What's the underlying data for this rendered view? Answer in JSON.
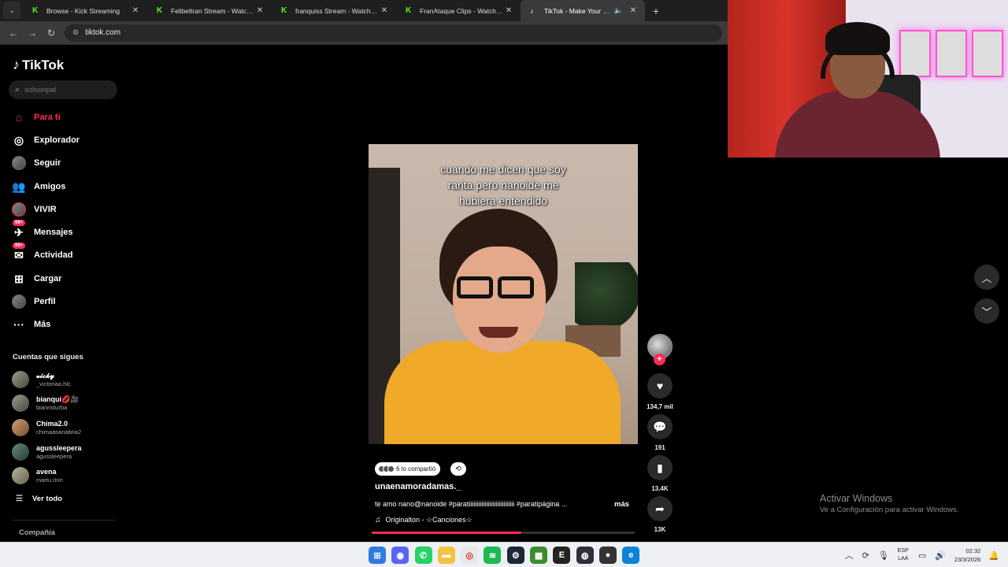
{
  "browser": {
    "tabs": [
      {
        "title": "Browse - Kick Streaming",
        "favicon": "kick-icon",
        "active": false
      },
      {
        "title": "Felibeltran Stream - Watch Live",
        "favicon": "kick-icon",
        "active": false
      },
      {
        "title": "franquiss Stream - Watch Live o",
        "favicon": "kick-icon",
        "active": false
      },
      {
        "title": "FranAtaque Clips - Watch Live o",
        "favicon": "kick-icon",
        "active": false
      },
      {
        "title": "TikTok - Make Your Day",
        "favicon": "tiktok-icon",
        "active": true
      }
    ],
    "url": "tiktok.com"
  },
  "tiktok": {
    "logo_text": "TikTok",
    "search_placeholder": "solsonpai",
    "nav": [
      {
        "label": "Para ti",
        "icon": "home-icon",
        "active": true
      },
      {
        "label": "Explorador",
        "icon": "compass-icon"
      },
      {
        "label": "Seguir",
        "icon": "following-avatar-icon"
      },
      {
        "label": "Amigos",
        "icon": "friends-icon"
      },
      {
        "label": "VIVIR",
        "icon": "live-icon"
      },
      {
        "label": "Mensajes",
        "icon": "messages-icon",
        "badge": "99+"
      },
      {
        "label": "Actividad",
        "icon": "activity-icon",
        "badge": "99+"
      },
      {
        "label": "Cargar",
        "icon": "upload-icon"
      },
      {
        "label": "Perfil",
        "icon": "profile-avatar-icon"
      },
      {
        "label": "Más",
        "icon": "more-dots-icon"
      }
    ],
    "following_title": "Cuentas que sigues",
    "following": [
      {
        "name": "𝓿𝓲𝓬𝓴𝔂",
        "handle": "_victoriaa.hlc"
      },
      {
        "name": "bianqui💋🎥",
        "handle": "biannsturba"
      },
      {
        "name": "Chima2.0",
        "handle": "chimaasanabria2"
      },
      {
        "name": "agussleepera",
        "handle": "agussleepera"
      },
      {
        "name": "avena",
        "handle": "martu.rinn"
      }
    ],
    "see_all": "Ver todo",
    "company": "Compañía"
  },
  "video": {
    "caption": "cuando me dicen que soy\nrarita pero nanoide me\nhubiera entendido",
    "shared_label": "6 lo compartió",
    "author": "unaenamoradamas._",
    "description": "te amo nano@nanoide #paratiiiiiiiiiiiiiiiiiiiiiiiiiiiii #paratipágina ...",
    "more_label": "más",
    "music": "Originalton - ☆Canciones☆",
    "progress": 0.57,
    "likes": "134,7 mil",
    "comments": "191",
    "saves": "13.4K",
    "shares": "13K"
  },
  "watermark": {
    "title": "Activar Windows",
    "subtitle": "Ve a Configuración para activar Windows."
  },
  "taskbar": {
    "apps": [
      "windows-start-icon",
      "discord-icon",
      "whatsapp-icon",
      "file-explorer-icon",
      "chrome-icon",
      "spotify-icon",
      "steam-icon",
      "minecraft-icon",
      "epic-games-icon",
      "obs-icon",
      "app-red-dot-icon",
      "edge-icon"
    ],
    "lang": "ESP",
    "layout": "LAA",
    "time": "02:32",
    "date": "23/3/2026"
  }
}
